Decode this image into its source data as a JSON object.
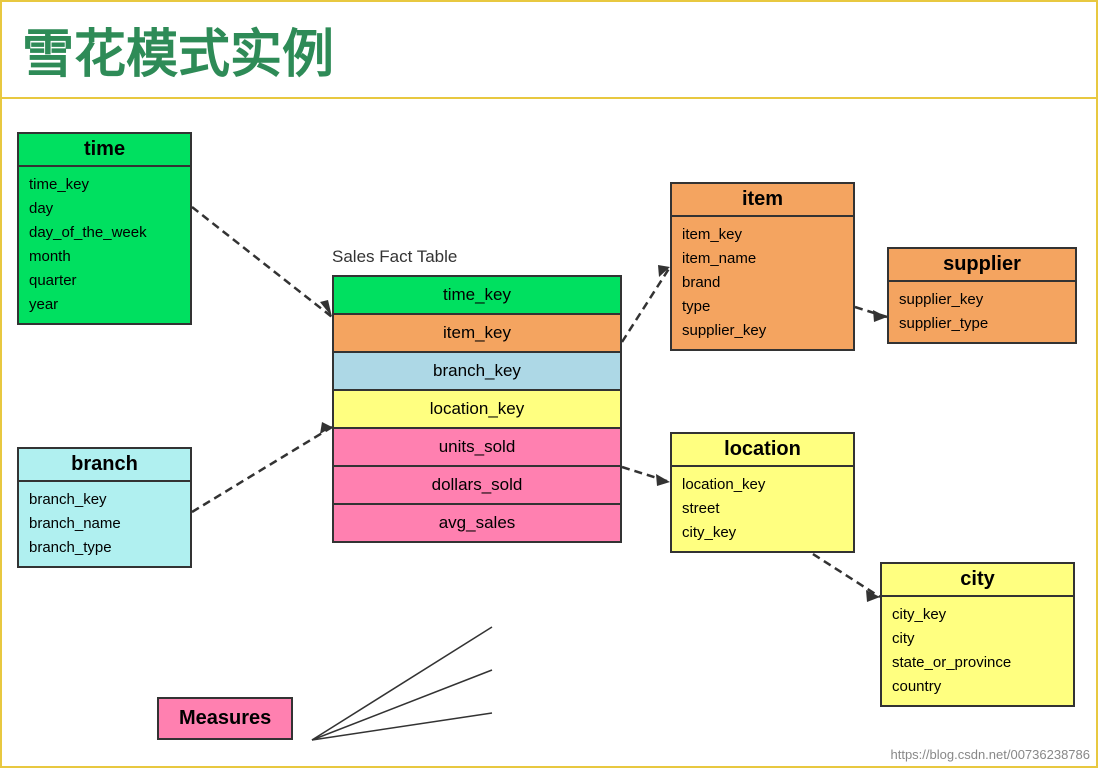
{
  "title": "雪花模式实例",
  "time_table": {
    "header": "time",
    "fields": [
      "time_key",
      "day",
      "day_of_the_week",
      "month",
      "quarter",
      "year"
    ]
  },
  "branch_table": {
    "header": "branch",
    "fields": [
      "branch_key",
      "branch_name",
      "branch_type"
    ]
  },
  "fact_table": {
    "label": "Sales Fact Table",
    "rows": [
      "time_key",
      "item_key",
      "branch_key",
      "location_key",
      "units_sold",
      "dollars_sold",
      "avg_sales"
    ]
  },
  "item_table": {
    "header": "item",
    "fields": [
      "item_key",
      "item_name",
      "brand",
      "type",
      "supplier_key"
    ]
  },
  "supplier_table": {
    "header": "supplier",
    "fields": [
      "supplier_key",
      "supplier_type"
    ]
  },
  "location_table": {
    "header": "location",
    "fields": [
      "location_key",
      "street",
      "city_key"
    ]
  },
  "city_table": {
    "header": "city",
    "fields": [
      "city_key",
      "city",
      "state_or_province",
      "country"
    ]
  },
  "measures_label": "Measures",
  "watermark": "https://blog.csdn.net/00736238786"
}
